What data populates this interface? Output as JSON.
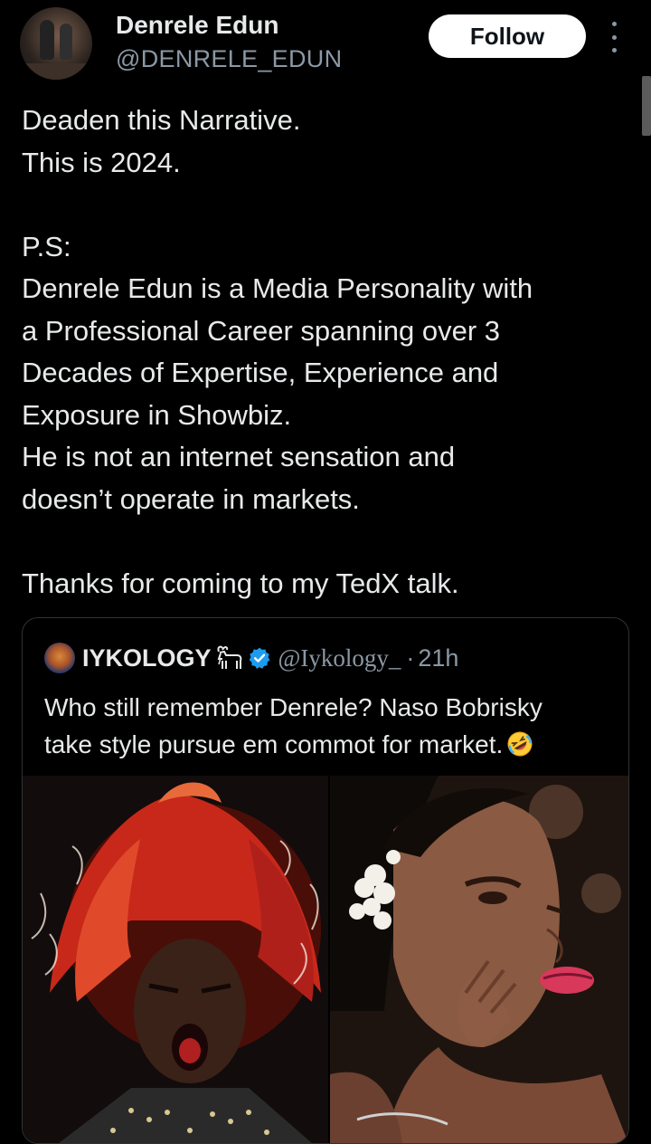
{
  "tweet": {
    "author": {
      "name": "Denrele Edun",
      "handle": "@DENRELE_EDUN"
    },
    "follow_label": "Follow",
    "text_lines": [
      "Deaden this Narrative.",
      "This is 2024.",
      "",
      "P.S:",
      "Denrele Edun is a Media Personality with",
      "a Professional Career spanning over 3",
      "Decades of Expertise, Experience and",
      "Exposure in Showbiz.",
      "He is not an internet sensation and",
      "doesn’t operate in markets.",
      "",
      "Thanks for coming to my TedX talk."
    ]
  },
  "quoted_tweet": {
    "name": "IYKOLOGY",
    "handle": "@Iykology_",
    "separator": "·",
    "time": "21h",
    "text_lines": [
      "Who still remember Denrele? Naso Bobrisky",
      "take style pursue em commot for market."
    ],
    "emoji": "rolling-on-floor-laughing",
    "media": [
      {
        "name": "photo-red-hair-shouting"
      },
      {
        "name": "photo-pink-lips-flower-headpiece"
      }
    ]
  },
  "colors": {
    "background": "#000000",
    "text_primary": "#e7e9ea",
    "text_secondary": "#8b98a5",
    "verified": "#1d9bf0",
    "border": "#2f3336"
  },
  "icons": [
    "more-options-icon",
    "goat-icon",
    "verified-badge-icon",
    "rolling-laughing-emoji-icon"
  ]
}
